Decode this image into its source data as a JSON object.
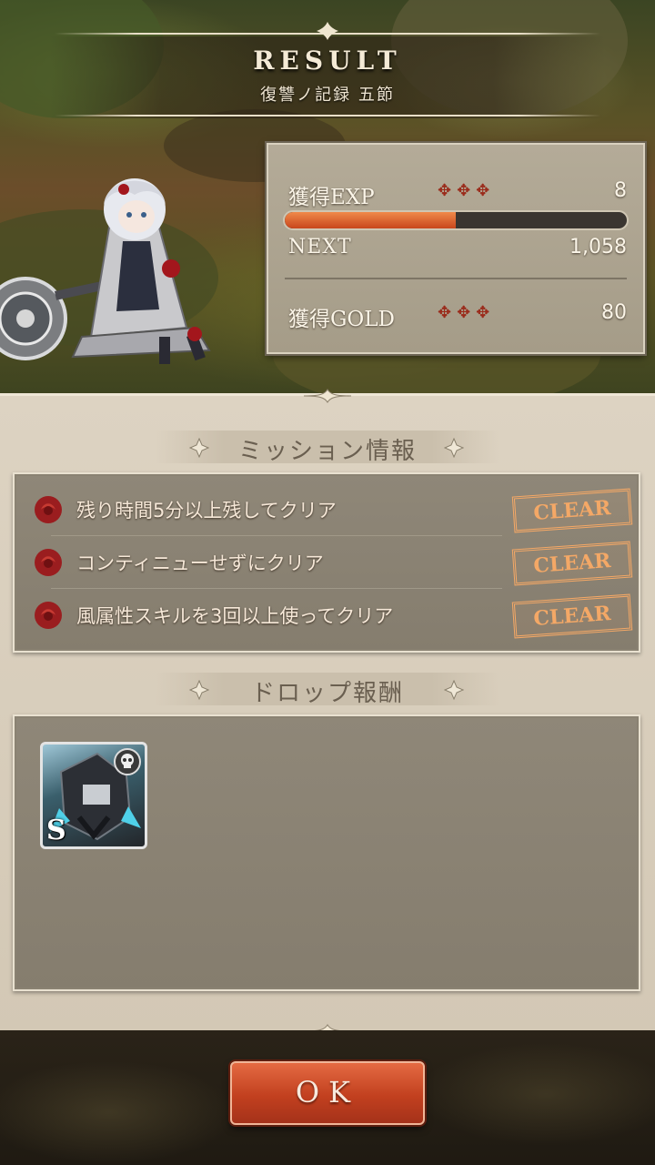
{
  "header": {
    "title": "RESULT",
    "stage": "復讐ノ記録 五節"
  },
  "stats": {
    "exp_label": "獲得EXP",
    "exp_value": "8",
    "exp_progress": 0.5,
    "next_label": "NEXT",
    "next_value": "1,058",
    "gold_label": "獲得GOLD",
    "gold_value": "80",
    "crosses": "✥✥✥"
  },
  "missions": {
    "title": "ミッション情報",
    "items": [
      {
        "text": "残り時間5分以上残してクリア",
        "status": "CLEAR"
      },
      {
        "text": "コンティニューせずにクリア",
        "status": "CLEAR"
      },
      {
        "text": "風属性スキルを3回以上使ってクリア",
        "status": "CLEAR"
      }
    ]
  },
  "drops": {
    "title": "ドロップ報酬",
    "items": [
      {
        "rank": "S",
        "icon": "armored-monster-icon",
        "badge": "skull-icon"
      }
    ]
  },
  "ok_button": "OK",
  "colors": {
    "accent": "#c8461c",
    "stamp": "#f4a866",
    "parchment": "#d8cdbb"
  }
}
